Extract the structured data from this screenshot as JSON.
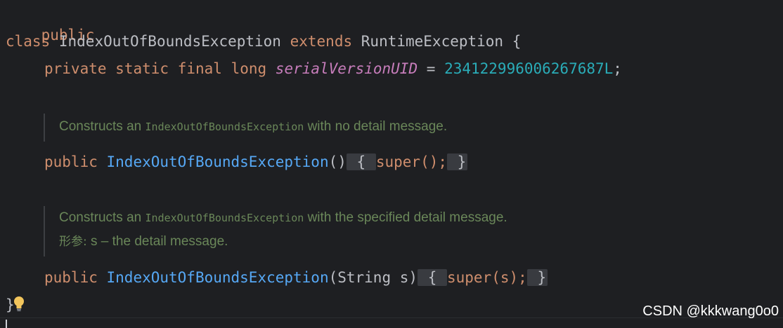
{
  "code": {
    "l1": {
      "kw": "public"
    },
    "l2": {
      "kw1": "class",
      "name": "IndexOutOfBoundsException",
      "kw2": "extends",
      "super": "RuntimeException",
      "brace": "{"
    },
    "l3": {
      "kw1": "private",
      "kw2": "static",
      "kw3": "final",
      "kw4": "long",
      "field": "serialVersionUID",
      "eq": "=",
      "value": "234122996006267687L",
      "semi": ";"
    },
    "doc1": {
      "prefix": "Constructs an",
      "code": "IndexOutOfBoundsException",
      "suffix": "with no detail message."
    },
    "l4": {
      "kw": "public",
      "name": "IndexOutOfBoundsException",
      "parens": "()",
      "open": "{",
      "body": "super();",
      "close": "}"
    },
    "doc2": {
      "prefix": "Constructs an",
      "code": "IndexOutOfBoundsException",
      "suffix": "with the specified detail message.",
      "param_label": "形参:",
      "param_name": "s",
      "param_desc": "– the detail message."
    },
    "l5": {
      "kw": "public",
      "name": "IndexOutOfBoundsException",
      "params": "(String s)",
      "open": "{",
      "body": "super(s);",
      "close": "}"
    },
    "l6": {
      "brace": "}"
    }
  },
  "icons": {
    "bulb": "lightbulb-icon"
  },
  "watermark": "CSDN @kkkwang0o0",
  "colors": {
    "background": "#1e1f22",
    "keyword": "#cf8e6d",
    "function": "#56a8f5",
    "field": "#c77dbb",
    "number": "#2aacb8",
    "doc": "#6a8759",
    "text": "#bcbec4"
  }
}
